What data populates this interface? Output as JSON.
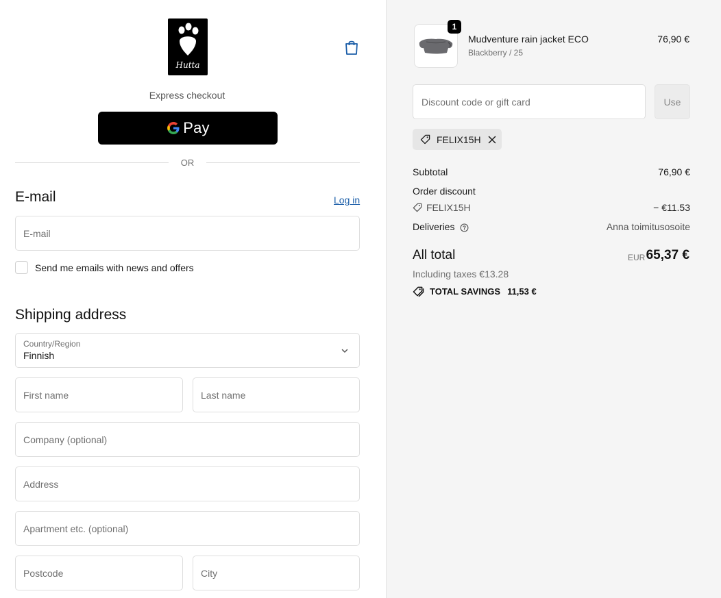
{
  "header": {
    "brand": "Hutta",
    "cart_icon": "shopping-bag-icon"
  },
  "express": {
    "label": "Express checkout",
    "gpay_label": "Pay"
  },
  "divider": {
    "or": "OR"
  },
  "email_section": {
    "title": "E-mail",
    "login_link": "Log in",
    "email_placeholder": "E-mail",
    "newsletter_label": "Send me emails with news and offers"
  },
  "shipping": {
    "title": "Shipping address",
    "country_label": "Country/Region",
    "country_value": "Finnish",
    "first_name_placeholder": "First name",
    "last_name_placeholder": "Last name",
    "company_placeholder": "Company (optional)",
    "address_placeholder": "Address",
    "apartment_placeholder": "Apartment etc. (optional)",
    "postcode_placeholder": "Postcode",
    "city_placeholder": "City"
  },
  "order": {
    "item": {
      "quantity": "1",
      "name": "Mudventure rain jacket ECO",
      "variant": "Blackberry / 25",
      "price": "76,90 €"
    },
    "discount_placeholder": "Discount code or gift card",
    "use_button": "Use",
    "applied_code": "FELIX15H",
    "subtotal_label": "Subtotal",
    "subtotal_value": "76,90 €",
    "order_discount_label": "Order discount",
    "discount_code": "FELIX15H",
    "discount_value": "− €11.53",
    "deliveries_label": "Deliveries",
    "deliveries_value": "Anna toimitusosoite",
    "total_label": "All total",
    "total_currency": "EUR",
    "total_value": "65,37 €",
    "taxes_text": "Including taxes €13.28",
    "savings_label": "TOTAL SAVINGS",
    "savings_value": "11,53 €"
  },
  "colors": {
    "link": "#1a5da8",
    "summary_bg": "#f5f5f5",
    "button_dark": "#000000"
  }
}
